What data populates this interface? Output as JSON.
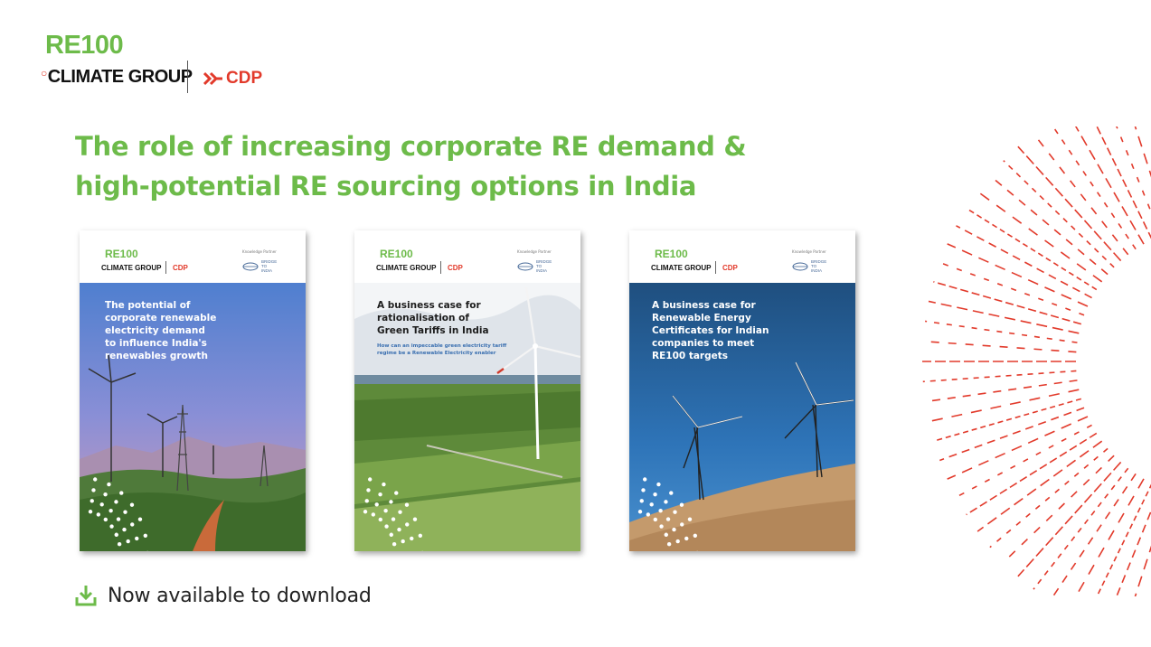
{
  "logos": {
    "re100": "RE100",
    "climate_group": "CLIMATE GROUP",
    "cdp": "CDP"
  },
  "headline": {
    "line1": "The role of increasing corporate RE demand &",
    "line2": "high-potential RE sourcing options in India"
  },
  "reports": [
    {
      "re100": "RE100",
      "climate_group": "CLIMATE GROUP",
      "cdp": "CDP",
      "partner_label": "Knowledge Partner",
      "partner_name": [
        "BRIDGE",
        "TO",
        "INDIA"
      ],
      "title": [
        "The potential of",
        "corporate renewable",
        "electricity demand",
        "to influence India's",
        "renewables growth"
      ],
      "subtitle": []
    },
    {
      "re100": "RE100",
      "climate_group": "CLIMATE GROUP",
      "cdp": "CDP",
      "partner_label": "Knowledge Partner",
      "partner_name": [
        "BRIDGE",
        "TO",
        "INDIA"
      ],
      "title": [
        "A business case for",
        "rationalisation of",
        "Green Tariffs in India"
      ],
      "subtitle": [
        "How can an impeccable green electricity tariff",
        "regime be a Renewable Electricity enabler"
      ]
    },
    {
      "re100": "RE100",
      "climate_group": "CLIMATE GROUP",
      "cdp": "CDP",
      "partner_label": "Knowledge Partner",
      "partner_name": [
        "BRIDGE",
        "TO",
        "INDIA"
      ],
      "title": [
        "A business case for",
        "Renewable Energy",
        "Certificates for Indian",
        "companies to meet",
        "RE100 targets"
      ],
      "subtitle": []
    }
  ],
  "download": {
    "label": "Now available to download",
    "icon": "download-icon"
  },
  "colors": {
    "brand_green": "#6dbb4a",
    "brand_red": "#e23a2b"
  }
}
